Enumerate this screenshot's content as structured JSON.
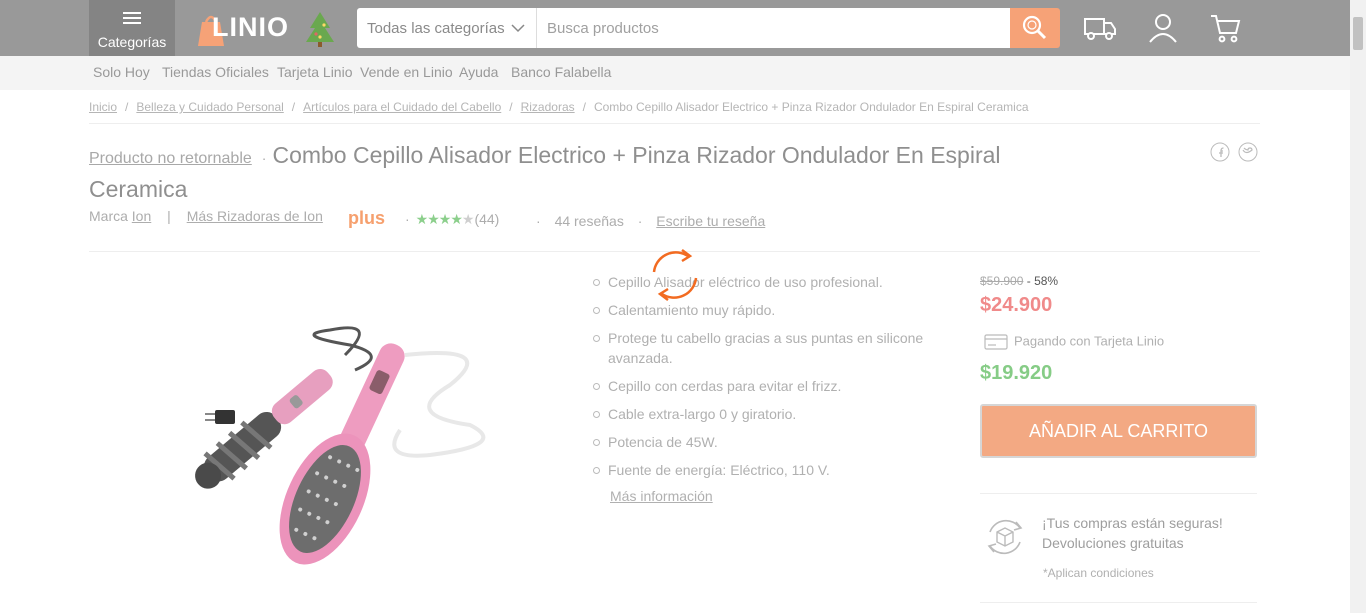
{
  "header": {
    "categories_label": "Categorías",
    "logo_text": "LINIO",
    "search_category": "Todas las categorías",
    "search_placeholder": "Busca productos"
  },
  "subnav": [
    "Solo Hoy",
    "Tiendas Oficiales",
    "Tarjeta Linio",
    "Vende en Linio",
    "Ayuda",
    "Banco Falabella"
  ],
  "breadcrumb": {
    "links": [
      "Inicio",
      "Belleza y Cuidado Personal",
      "Artículos para el Cuidado del Cabello",
      "Rizadoras"
    ],
    "current": "Combo Cepillo Alisador Electrico + Pinza Rizador Ondulador En Espiral Ceramica"
  },
  "product": {
    "nonreturnable": "Producto no retornable",
    "title": "Combo Cepillo Alisador Electrico + Pinza Rizador Ondulador En Espiral Ceramica",
    "brand_label": "Marca",
    "brand": "Ion",
    "more_from_brand": "Más Rizadoras de Ion",
    "plus_badge": "plus",
    "rating": 4,
    "rating_count": "(44)",
    "reviews": "44 reseñas",
    "write_review": "Escribe tu reseña",
    "features": [
      "Cepillo Alisador eléctrico de uso profesional.",
      "Calentamiento muy rápido.",
      "Protege tu cabello gracias a sus puntas en silicone avanzada.",
      "Cepillo con cerdas para evitar el frizz.",
      "Cable extra-largo 0 y giratorio.",
      "Potencia de 45W.",
      "Fuente de energía: Eléctrico, 110 V."
    ],
    "more_info": "Más información"
  },
  "pricing": {
    "old_price": "$59.900",
    "discount": "- 58%",
    "price": "$24.900",
    "card_label": "Pagando con Tarjeta Linio",
    "card_price": "$19.920",
    "add_to_cart": "AÑADIR AL CARRITO"
  },
  "guarantee": {
    "line1": "¡Tus compras están seguras!",
    "line2": "Devoluciones gratuitas",
    "note": "*Aplican condiciones"
  },
  "colors": {
    "accent": "#f6a277",
    "price_red": "#f08a8a",
    "price_green": "#86cc86",
    "spinner": "#f26b21"
  }
}
